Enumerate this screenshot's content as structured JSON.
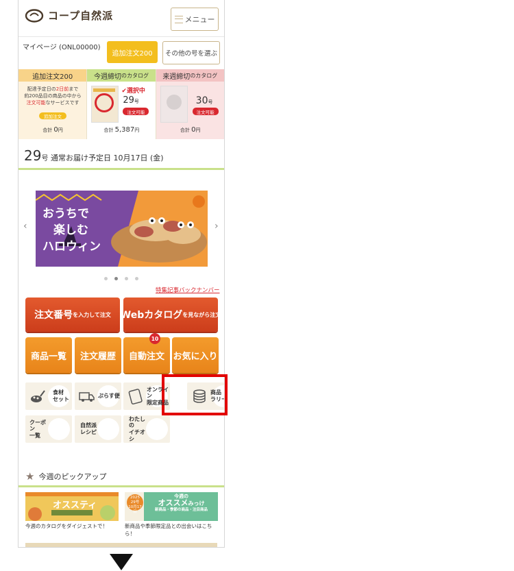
{
  "header": {
    "logo_text": "コープ自然派",
    "menu_label": "メニュー"
  },
  "account": {
    "mypage_label": "マイページ (ONL00000)",
    "add_order_button": "追加注文200",
    "other_issue_button": "その他の号を選ぶ"
  },
  "catalog_columns": [
    {
      "header": "追加注文200",
      "desc_1": "配達予定日の",
      "desc_red_1": "2日前",
      "desc_2": "まで",
      "desc_3": "約200品目の商品の中から",
      "desc_red_2": "注文可能",
      "desc_4": "なサービスです",
      "pill": "追加注文",
      "total_label": "合計",
      "total_value": "0",
      "total_unit": "円"
    },
    {
      "header_main": "今週締切",
      "header_sub": "のカタログ",
      "status": "✔選択中",
      "issue_no": "29",
      "issue_unit": "号",
      "pill": "注文可能",
      "total_label": "合計",
      "total_value": "5,387",
      "total_unit": "円"
    },
    {
      "header_main": "来週締切",
      "header_sub": "のカタログ",
      "issue_no": "30",
      "issue_unit": "号",
      "pill": "注文可能",
      "total_label": "合計",
      "total_value": "0",
      "total_unit": "円"
    }
  ],
  "delivery": {
    "issue_no": "29",
    "issue_unit": "号",
    "text": "通常お届け予定日 10月17日 (金)"
  },
  "banner": {
    "line1": "おうちで",
    "line2": "楽しむ",
    "line3": "ハロウィン",
    "active_slide": 2,
    "slide_count": 4
  },
  "backnumber_link": "特集記事バックナンバー",
  "big_buttons": [
    {
      "bold": "注文番号",
      "small": "を入力して注文"
    },
    {
      "bold": "Webカタログ",
      "small": "を見ながら注文"
    }
  ],
  "mid_buttons": [
    {
      "label": "商品一覧"
    },
    {
      "label": "注文履歴"
    },
    {
      "label": "自動注文",
      "badge": "10"
    },
    {
      "label": "お気に入り"
    }
  ],
  "tiles": [
    {
      "l1": "食材",
      "l2": "セット",
      "icon": "food-set-icon"
    },
    {
      "l1": "ぷらす便",
      "l2": "",
      "icon": "truck-icon"
    },
    {
      "l1": "オンライン",
      "l2": "限定商品",
      "icon": "tablet-icon"
    },
    {
      "l1": "商品",
      "l2": "ラリー",
      "icon": "coin-stack-icon"
    },
    {
      "l1": "クーポン",
      "l2": "一覧",
      "icon": "coupon-icon"
    },
    {
      "l1": "自然派",
      "l2": "レシピ",
      "icon": "cutlery-icon"
    },
    {
      "l1": "わたしの",
      "l2": "イチオシ",
      "icon": "thumbs-up-icon"
    }
  ],
  "pickup": {
    "title": "今週のピックアップ",
    "item1_title": "オススティ",
    "item1_caption": "今週のカタログをダイジェストで！",
    "item2_badge_year": "2025",
    "item2_badge_no": "29号",
    "item2_badge_date": "10月17日",
    "item2_title_1": "今週の",
    "item2_title_2": "オススメ",
    "item2_title_3": "みっけ",
    "item2_sub": "新商品・季節の商品・注目商品",
    "item2_caption_1": "新商品や季節限定品との出会いはこち",
    "item2_caption_2": "ら！"
  },
  "colors": {
    "accent_orange": "#e8841a",
    "accent_red": "#cc3d1b",
    "green_line": "#c9e18a",
    "highlight_red": "#e20000"
  }
}
